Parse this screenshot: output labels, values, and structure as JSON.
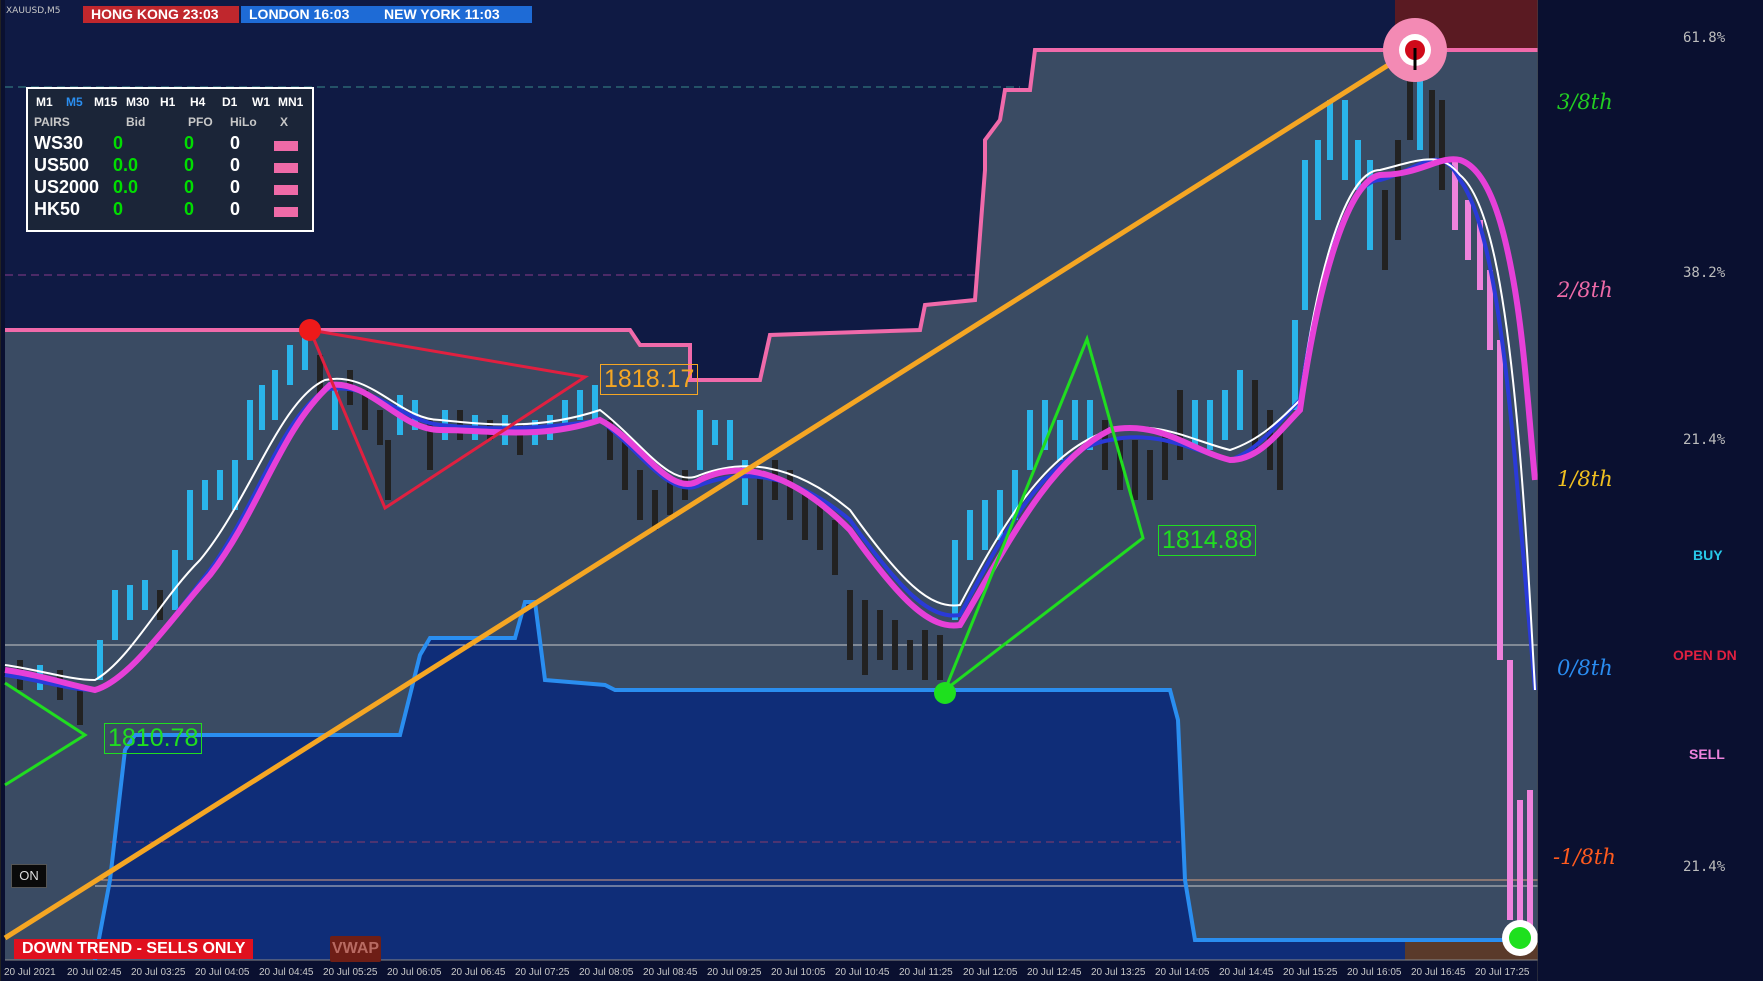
{
  "window": {
    "symbol": "XAUUSD,M5"
  },
  "clocks": [
    {
      "label": "HONG KONG 23:03",
      "color": "#c0272d"
    },
    {
      "label": "LONDON  16:03",
      "color": "#1e6bd6"
    },
    {
      "label": "NEW YORK  11:03",
      "color": "#1e6bd6"
    }
  ],
  "panel": {
    "timeframes": [
      "M1",
      "M5",
      "M15",
      "M30",
      "H1",
      "H4",
      "D1",
      "W1",
      "MN1"
    ],
    "active_timeframe": "M5",
    "headers": [
      "PAIRS",
      "Bid",
      "PFO",
      "HiLo",
      "X"
    ],
    "rows": [
      {
        "pair": "WS30",
        "bid": "0",
        "pfo": "0",
        "hilo": "0"
      },
      {
        "pair": "US500",
        "bid": "0.0",
        "pfo": "0",
        "hilo": "0"
      },
      {
        "pair": "US2000",
        "bid": "0.0",
        "pfo": "0",
        "hilo": "0"
      },
      {
        "pair": "HK50",
        "bid": "0",
        "pfo": "0",
        "hilo": "0"
      }
    ]
  },
  "murrey": [
    {
      "label": "3/8th",
      "color": "#22cc22"
    },
    {
      "label": "2/8th",
      "color": "#ee6aa7"
    },
    {
      "label": "1/8th",
      "color": "#f0c020"
    },
    {
      "label": "0/8th",
      "color": "#2a8cf0"
    },
    {
      "label": "-1/8th",
      "color": "#ff5a1e"
    }
  ],
  "fib": [
    "61.8%",
    "38.2%",
    "21.4%",
    "21.4%"
  ],
  "signals": {
    "buy": "BUY",
    "open": "OPEN DN",
    "sell": "SELL"
  },
  "labels": {
    "p1": "1818.17",
    "p2": "1814.88",
    "p3": "1810.78"
  },
  "status": {
    "trend": "DOWN TREND - SELLS ONLY",
    "vwap": "VWAP",
    "on": "ON"
  },
  "time_axis": [
    "20 Jul 2021",
    "20 Jul 02:45",
    "20 Jul 03:25",
    "20 Jul 04:05",
    "20 Jul 04:45",
    "20 Jul 05:25",
    "20 Jul 06:05",
    "20 Jul 06:45",
    "20 Jul 07:25",
    "20 Jul 08:05",
    "20 Jul 08:45",
    "20 Jul 09:25",
    "20 Jul 10:05",
    "20 Jul 10:45",
    "20 Jul 11:25",
    "20 Jul 12:05",
    "20 Jul 12:45",
    "20 Jul 13:25",
    "20 Jul 14:05",
    "20 Jul 14:45",
    "20 Jul 15:25",
    "20 Jul 16:05",
    "20 Jul 16:45",
    "20 Jul 17:25"
  ]
}
